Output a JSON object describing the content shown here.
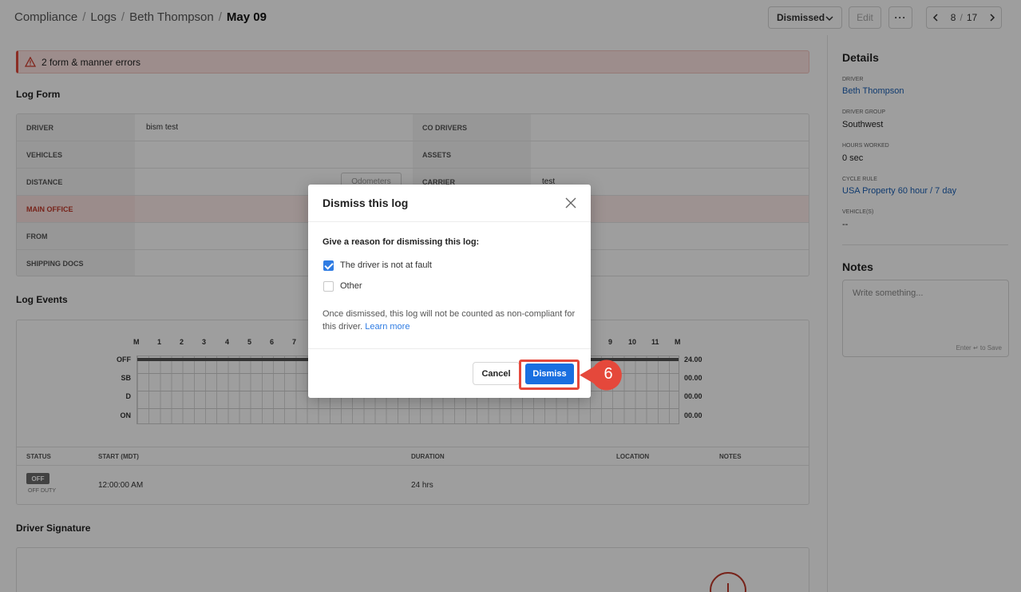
{
  "breadcrumb": {
    "items": [
      "Compliance",
      "Logs",
      "Beth Thompson"
    ],
    "current": "May 09",
    "separator": "/"
  },
  "toolbar": {
    "status_value": "Dismissed",
    "edit_label": "Edit",
    "more_label": "···",
    "pager_current": "8",
    "pager_total": "17",
    "pager_sep": "/"
  },
  "alert": {
    "text": "2 form & manner errors"
  },
  "log_form": {
    "title": "Log Form",
    "rows": [
      {
        "left_label": "DRIVER",
        "left_value": "bism test",
        "right_label": "CO DRIVERS",
        "right_value": ""
      },
      {
        "left_label": "VEHICLES",
        "left_value": "",
        "right_label": "ASSETS",
        "right_value": ""
      },
      {
        "left_label": "DISTANCE",
        "left_value": "",
        "right_label": "CARRIER",
        "right_value": "test"
      },
      {
        "left_label": "MAIN OFFICE",
        "left_value": "",
        "right_label": "",
        "right_value": ""
      },
      {
        "left_label": "FROM",
        "left_value": "",
        "right_label": "",
        "right_value": ""
      },
      {
        "left_label": "SHIPPING DOCS",
        "left_value": "",
        "right_label": "",
        "right_value": ""
      }
    ],
    "odometers_label": "Odometers"
  },
  "log_events": {
    "title": "Log Events",
    "hour_labels": [
      "M",
      "1",
      "2",
      "3",
      "4",
      "5",
      "6",
      "7",
      "9",
      "10",
      "11",
      "M"
    ],
    "rows": [
      {
        "label": "OFF",
        "total": "24.00"
      },
      {
        "label": "SB",
        "total": "00.00"
      },
      {
        "label": "D",
        "total": "00.00"
      },
      {
        "label": "ON",
        "total": "00.00"
      }
    ],
    "columns": [
      "STATUS",
      "START (MDT)",
      "DURATION",
      "LOCATION",
      "NOTES"
    ],
    "entry": {
      "status_badge": "OFF",
      "status_sub": "OFF DUTY",
      "start": "12:00:00 AM",
      "duration": "24 hrs"
    }
  },
  "signature": {
    "title": "Driver Signature"
  },
  "details": {
    "title": "Details",
    "driver_label": "DRIVER",
    "driver_value": "Beth Thompson",
    "group_label": "DRIVER GROUP",
    "group_value": "Southwest",
    "hours_label": "HOURS WORKED",
    "hours_value": "0 sec",
    "cycle_label": "CYCLE RULE",
    "cycle_value": "USA Property 60 hour / 7 day",
    "vehicles_label": "VEHICLE(S)",
    "vehicles_value": "--"
  },
  "notes": {
    "title": "Notes",
    "placeholder": "Write something...",
    "hint": "Enter ↵ to Save"
  },
  "modal": {
    "title": "Dismiss this log",
    "prompt": "Give a reason for dismissing this log:",
    "options": [
      {
        "label": "The driver is not at fault",
        "checked": true
      },
      {
        "label": "Other",
        "checked": false
      }
    ],
    "note": "Once dismissed, this log will not be counted as non-compliant for this driver.",
    "learn_more": "Learn more",
    "cancel_label": "Cancel",
    "dismiss_label": "Dismiss"
  },
  "step_marker": {
    "number": "6",
    "color": "#e5483b"
  },
  "colors": {
    "accent": "#1a6fe0",
    "error": "#e04b3d",
    "link": "#1a5fb4"
  }
}
